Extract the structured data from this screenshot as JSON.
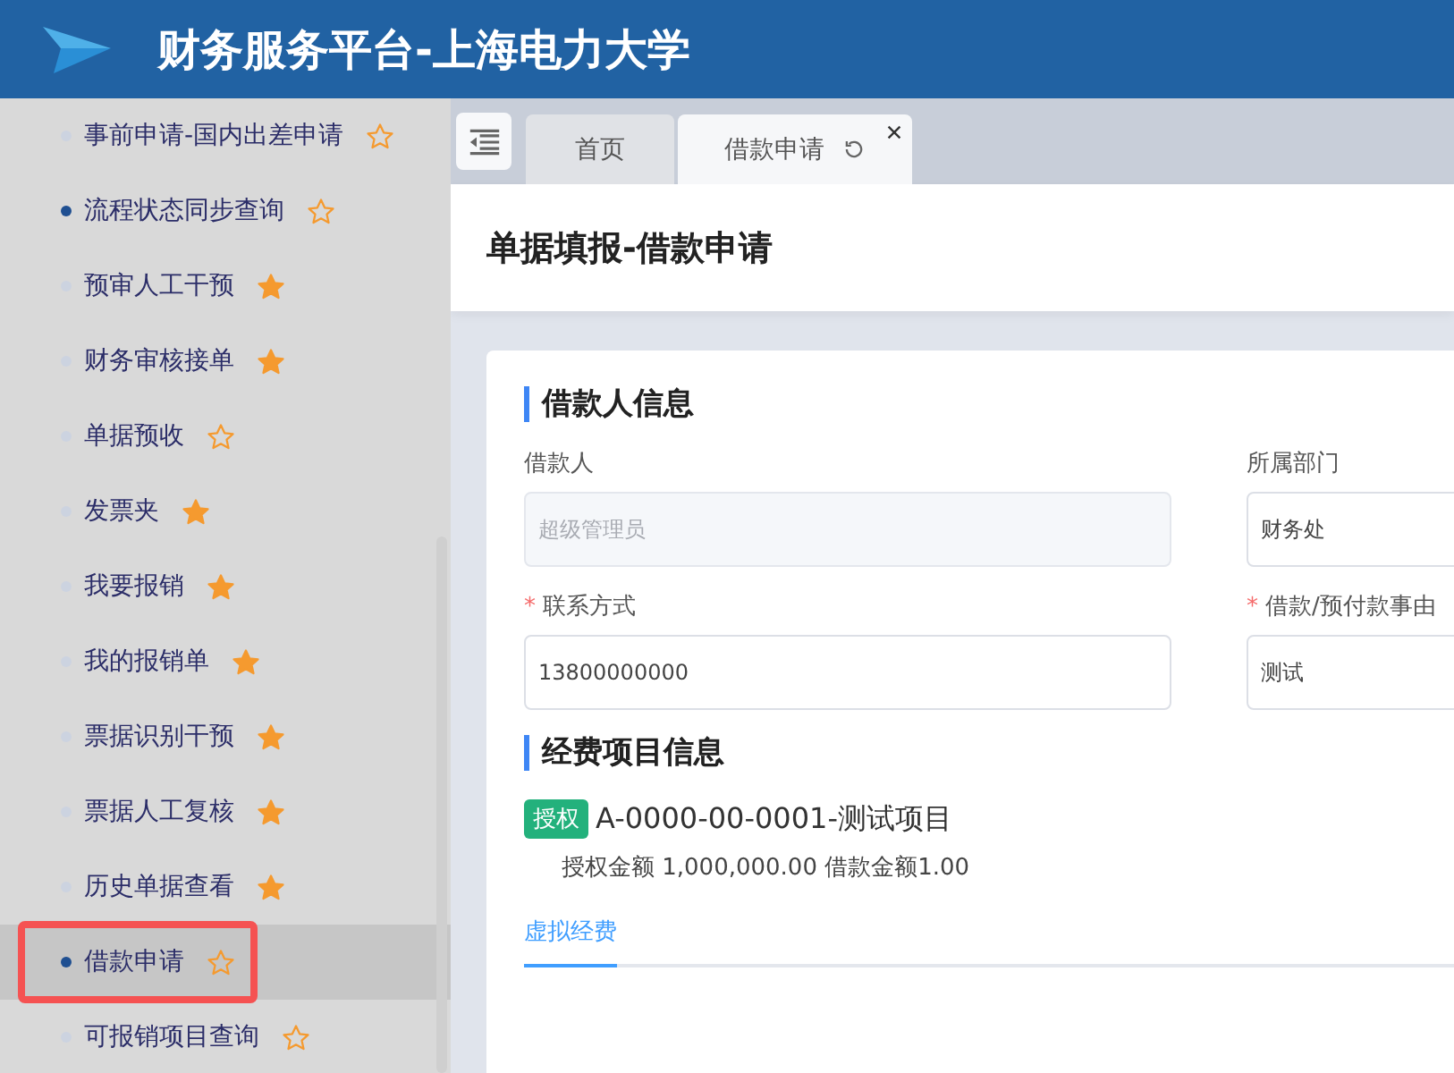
{
  "header": {
    "title": "财务服务平台-上海电力大学"
  },
  "sidebar": {
    "items": [
      {
        "label": "事前申请-国内出差申请",
        "marked": false,
        "starred": false,
        "selected": false,
        "annotated": false
      },
      {
        "label": "流程状态同步查询",
        "marked": true,
        "starred": false,
        "selected": false,
        "annotated": false
      },
      {
        "label": "预审人工干预",
        "marked": false,
        "starred": true,
        "selected": false,
        "annotated": false
      },
      {
        "label": "财务审核接单",
        "marked": false,
        "starred": true,
        "selected": false,
        "annotated": false
      },
      {
        "label": "单据预收",
        "marked": false,
        "starred": false,
        "selected": false,
        "annotated": false
      },
      {
        "label": "发票夹",
        "marked": false,
        "starred": true,
        "selected": false,
        "annotated": false
      },
      {
        "label": "我要报销",
        "marked": false,
        "starred": true,
        "selected": false,
        "annotated": false
      },
      {
        "label": "我的报销单",
        "marked": false,
        "starred": true,
        "selected": false,
        "annotated": false
      },
      {
        "label": "票据识别干预",
        "marked": false,
        "starred": true,
        "selected": false,
        "annotated": false
      },
      {
        "label": "票据人工复核",
        "marked": false,
        "starred": true,
        "selected": false,
        "annotated": false
      },
      {
        "label": "历史单据查看",
        "marked": false,
        "starred": true,
        "selected": false,
        "annotated": false
      },
      {
        "label": "借款申请",
        "marked": true,
        "starred": false,
        "selected": true,
        "annotated": true
      },
      {
        "label": "可报销项目查询",
        "marked": false,
        "starred": false,
        "selected": false,
        "annotated": false
      }
    ]
  },
  "tabs": [
    {
      "label": "首页",
      "selected": false,
      "closable": false
    },
    {
      "label": "借款申请",
      "selected": true,
      "closable": true
    }
  ],
  "page_title": "单据填报-借款申请",
  "borrower_section": {
    "title": "借款人信息",
    "fields": [
      {
        "label": "借款人",
        "value": "超级管理员",
        "disabled": true
      },
      {
        "label": "所属部门",
        "value": "财务处",
        "disabled": false
      },
      {
        "label": "联系方式",
        "required_mark": "*",
        "value": "13800000000",
        "disabled": false
      },
      {
        "label": "借款/预付款事由",
        "required_mark": "*",
        "value": "测试",
        "disabled": false
      }
    ]
  },
  "project_section": {
    "title": "经费项目信息",
    "projects": [
      {
        "tag": "授权",
        "name": "A-0000-00-0001-测试项目",
        "amounts": "授权金额 1,000,000.00 借款金额1.00"
      }
    ],
    "tabs": [
      {
        "label": "虚拟经费",
        "selected": true
      }
    ]
  }
}
